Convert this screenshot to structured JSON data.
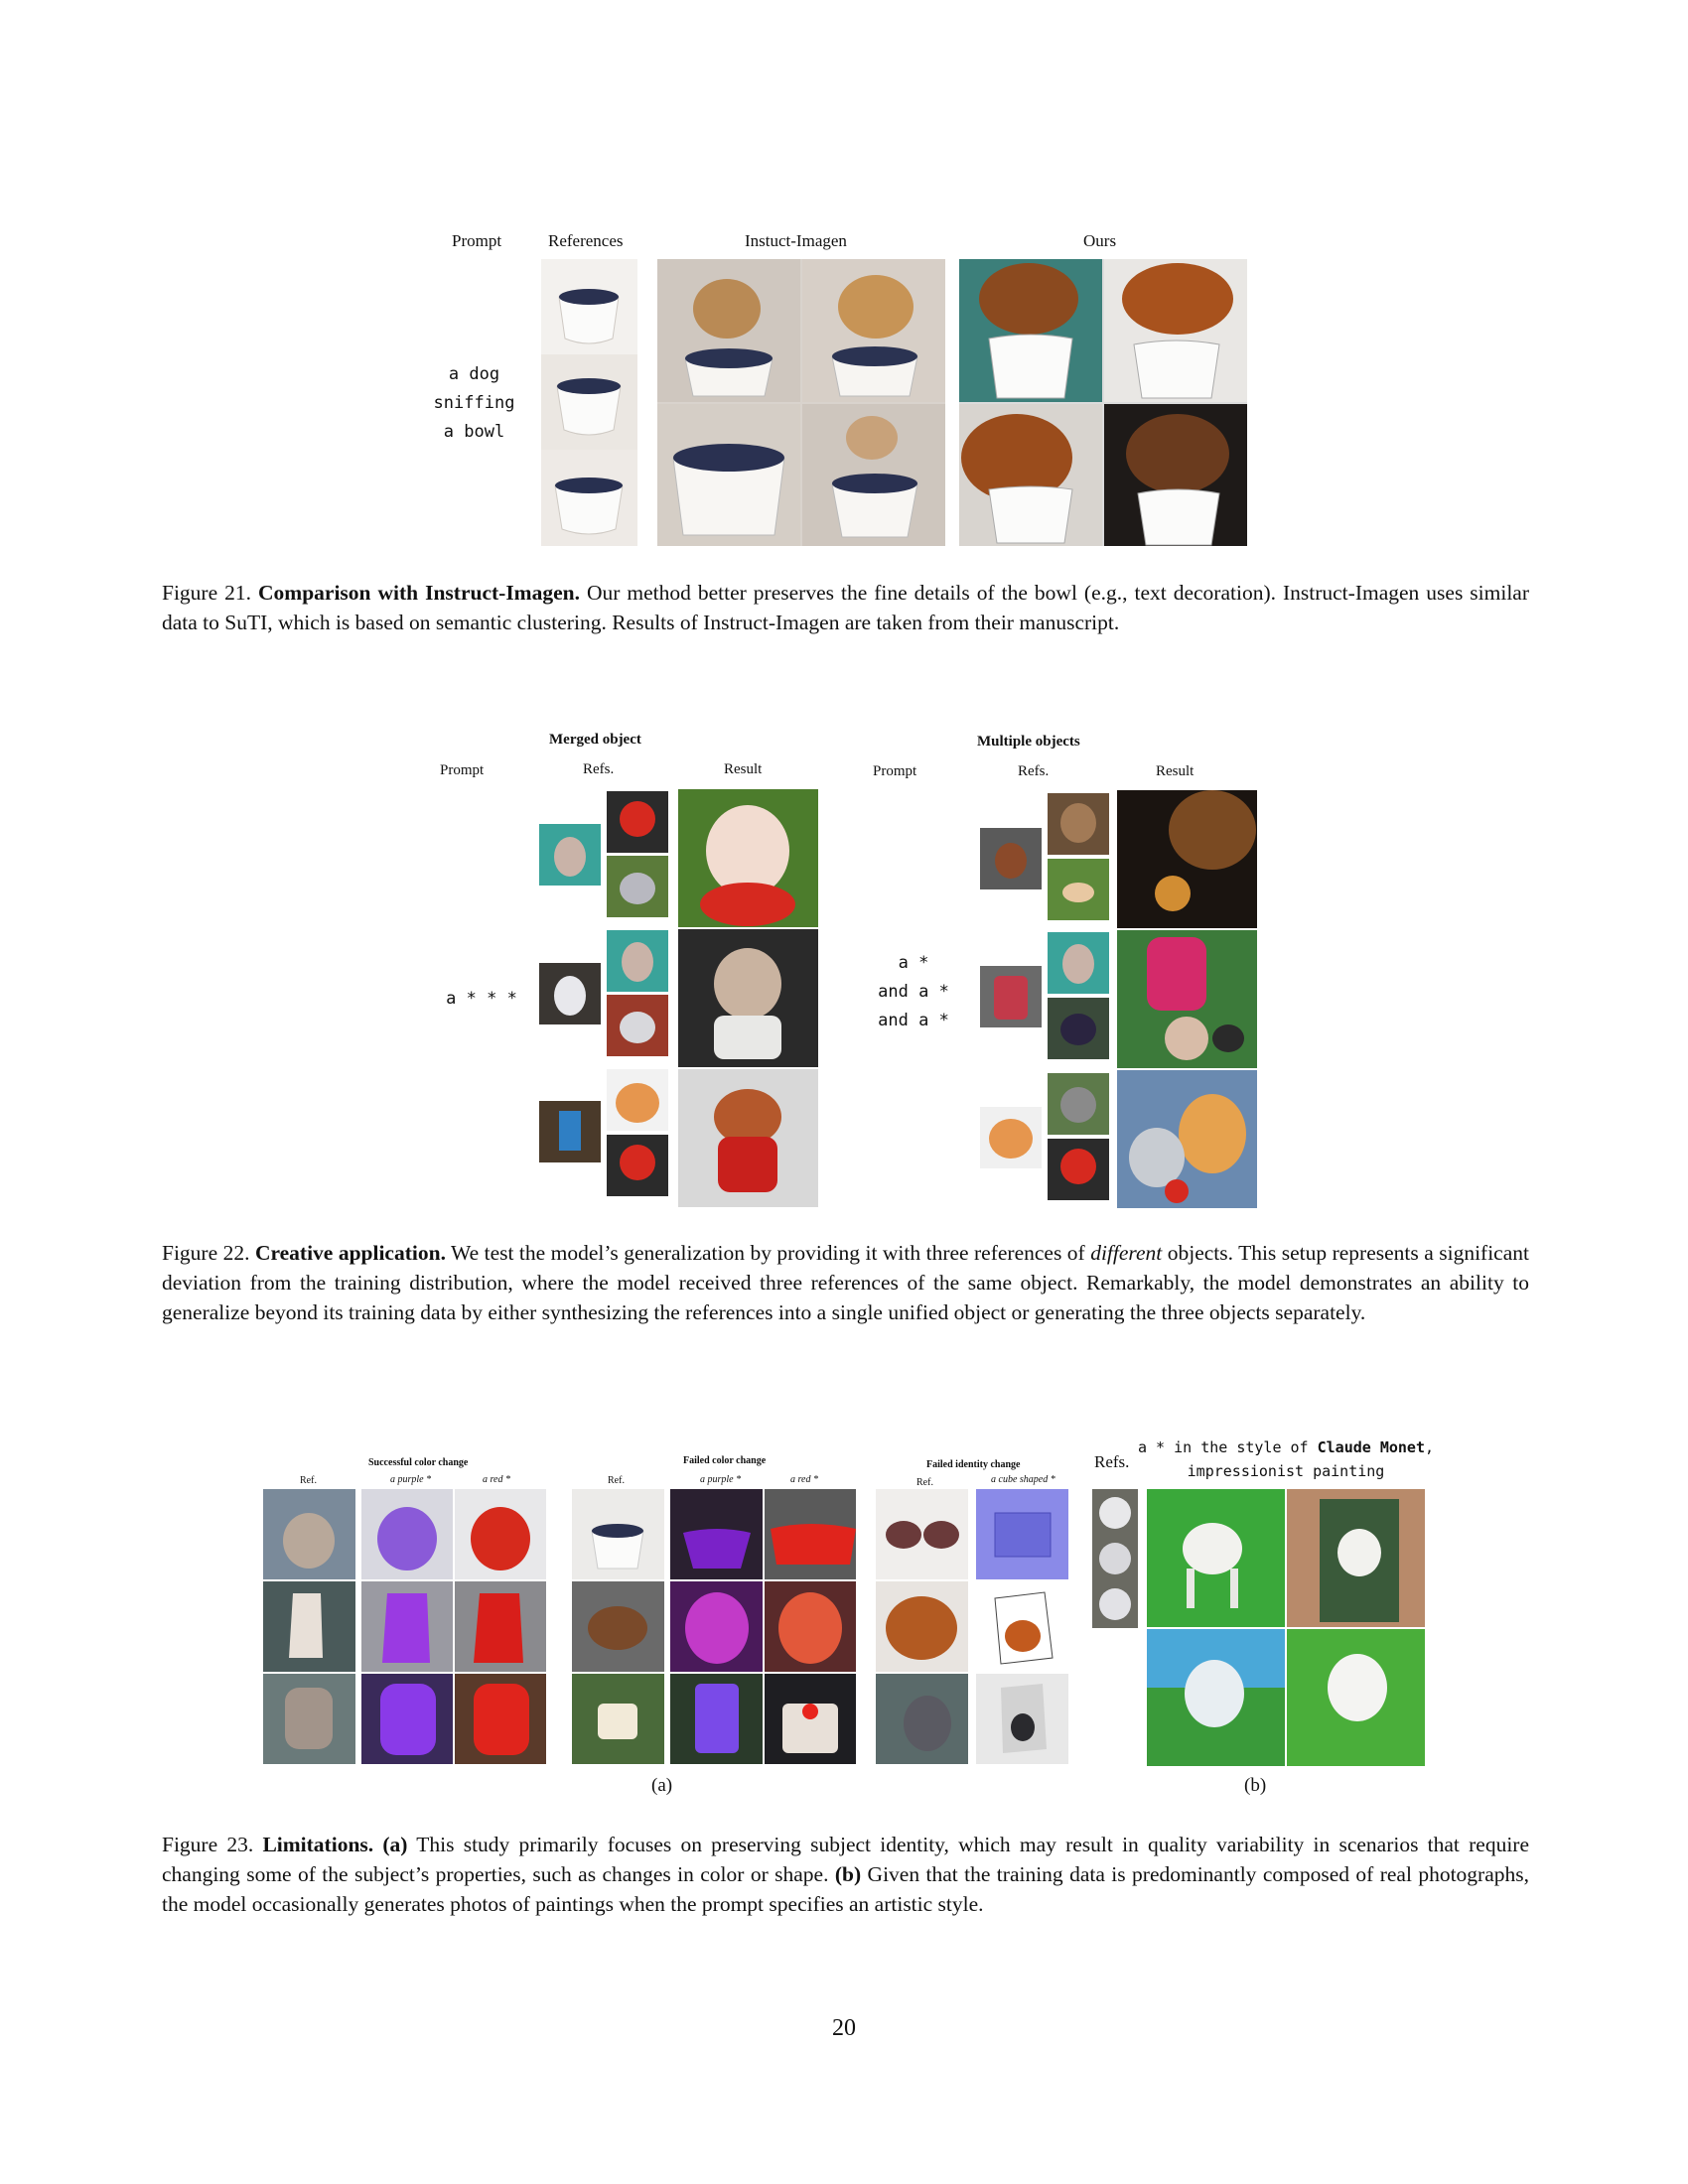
{
  "fig21": {
    "headers": {
      "prompt": "Prompt",
      "refs": "References",
      "instruct": "Instuct-Imagen",
      "ours": "Ours"
    },
    "prompt_lines": [
      "a dog",
      "sniffing",
      "a bowl"
    ],
    "caption_num": "Figure 21.",
    "caption_title": "Comparison with Instruct-Imagen.",
    "caption_text": " Our method better preserves the fine details of the bowl (e.g., text decoration). Instruct-Imagen uses similar data to SuTI, which is based on semantic clustering. Results of Instruct-Imagen are taken from their manuscript."
  },
  "fig22": {
    "merged_title": "Merged object",
    "multiple_title": "Multiple objects",
    "headers": {
      "prompt": "Prompt",
      "refs": "Refs.",
      "result": "Result"
    },
    "merged_prompt": "a * * *",
    "multiple_prompt_lines": [
      "a *",
      "and a *",
      "and a *"
    ],
    "caption_num": "Figure 22.",
    "caption_title": "Creative application.",
    "caption_text_1": " We test the model’s generalization by providing it with three references of ",
    "caption_italic": "different",
    "caption_text_2": " objects. This setup represents a significant deviation from the training distribution, where the model received three references of the same object. Remarkably, the model demonstrates an ability to generalize beyond its training data by either synthesizing the references into a single unified object or generating the three objects separately."
  },
  "fig23": {
    "panel_a": {
      "success_title": "Successful color change",
      "failed_color_title": "Failed color change",
      "failed_identity_title": "Failed identity change",
      "ref": "Ref.",
      "purple": "a purple *",
      "red": "a red *",
      "cube": "a cube shaped *",
      "label": "(a)"
    },
    "panel_b": {
      "refs": "Refs.",
      "prompt_line1_a": "a * in the style of ",
      "prompt_line1_b": "Claude Monet",
      "prompt_line1_c": ",",
      "prompt_line2": "impressionist painting",
      "label": "(b)"
    },
    "caption_num": "Figure 23.",
    "caption_title": "Limitations.",
    "caption_a_mark": "(a)",
    "caption_text_1": " This study primarily focuses on preserving subject identity, which may result in quality variability in scenarios that require changing some of the subject’s properties, such as changes in color or shape. ",
    "caption_b_mark": "(b)",
    "caption_text_2": " Given that the training data is predominantly composed of real photographs, the model occasionally generates photos of paintings when the prompt specifies an artistic style."
  },
  "page_number": "20"
}
